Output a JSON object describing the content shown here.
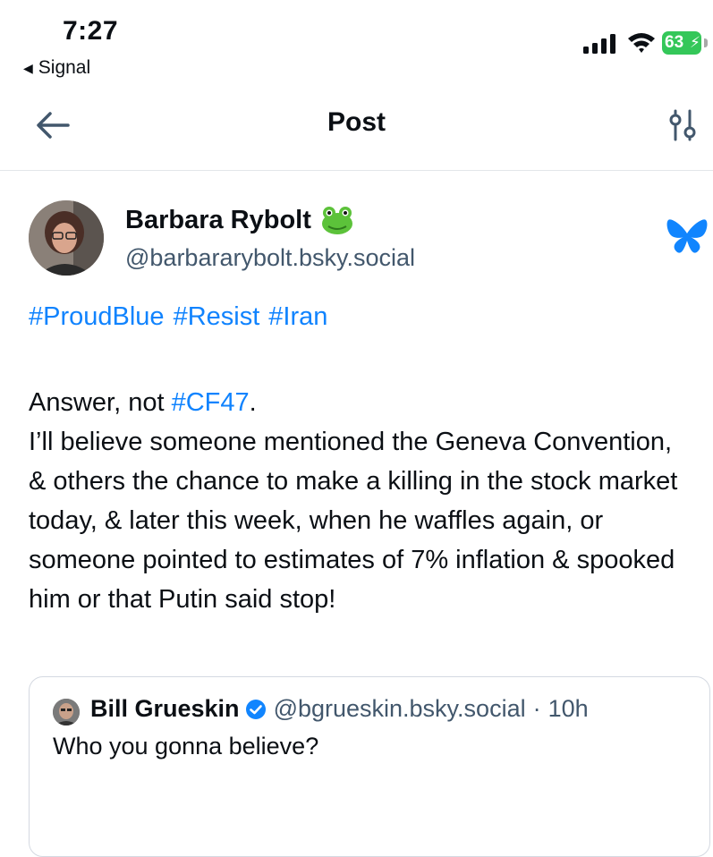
{
  "status_bar": {
    "time": "7:27",
    "back_app_label": "Signal",
    "battery_level": "63"
  },
  "header": {
    "title": "Post"
  },
  "post": {
    "author": {
      "name": "Barbara Rybolt",
      "handle": "@barbararybolt.bsky.social"
    },
    "hashtags": [
      "#ProudBlue",
      "#Resist",
      "#Iran"
    ],
    "line1_prefix": "Answer, not ",
    "line1_link": "#CF47",
    "line1_suffix": ".",
    "body": "I’ll believe someone  mentioned the Geneva Convention, & others the chance to make a killing in the stock market today, & later this week, when he waffles again, or someone pointed to estimates of 7% inflation & spooked him or that Putin said stop!",
    "quote": {
      "author_name": "Bill Grueskin",
      "handle": "@bgrueskin.bsky.social",
      "separator": "·",
      "time": "10h",
      "text": "Who you gonna believe?"
    }
  },
  "colors": {
    "link": "#1083fe",
    "battery": "#34c759",
    "muted": "#42576c"
  },
  "icons": [
    "back-arrow-icon",
    "filter-icon",
    "bluesky-butterfly-icon",
    "frog-emoji-icon",
    "verified-badge-icon",
    "cellular-signal-icon",
    "wifi-icon",
    "battery-icon"
  ]
}
